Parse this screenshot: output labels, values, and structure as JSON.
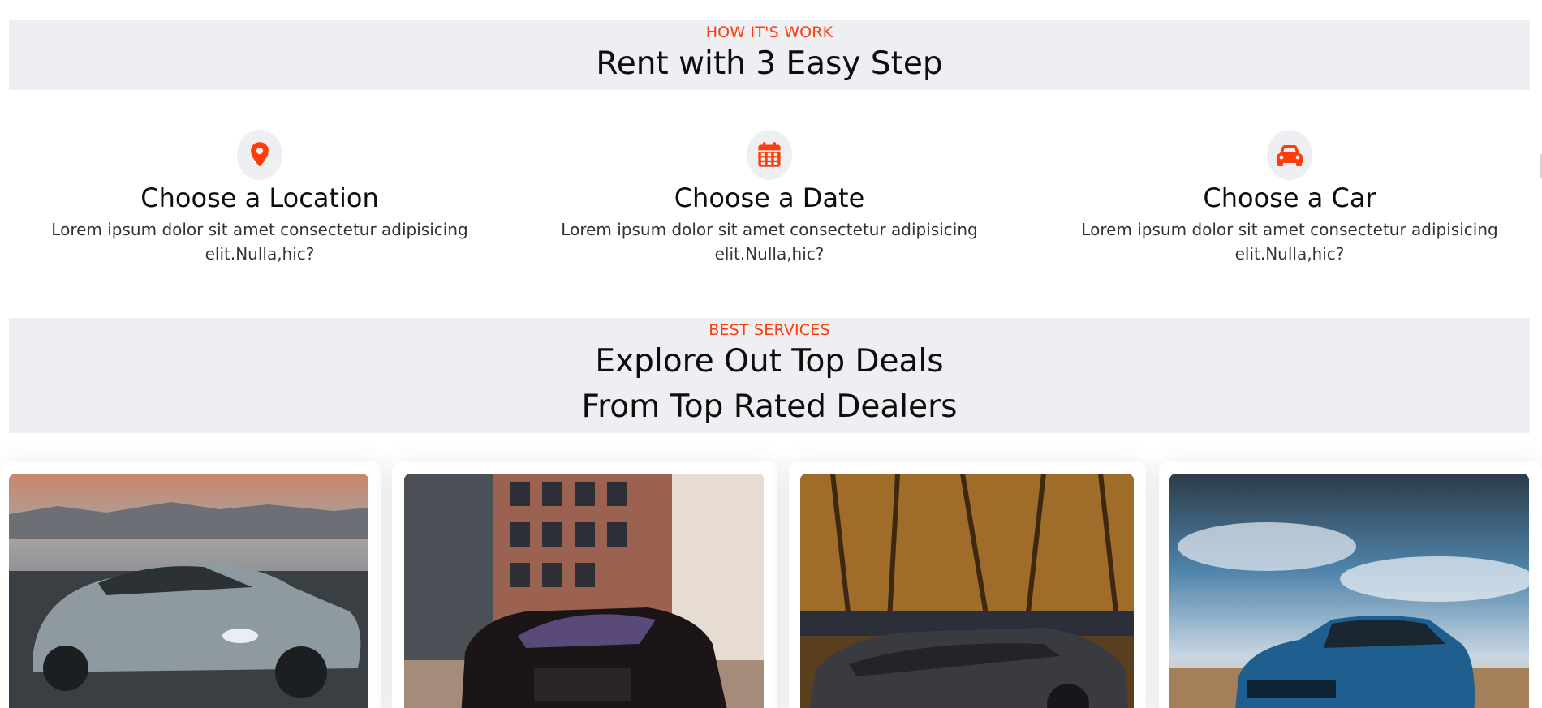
{
  "how_it_works": {
    "eyebrow": "HOW IT'S WORK",
    "heading": "Rent with 3 Easy Step"
  },
  "steps": [
    {
      "icon": "location-pin-icon",
      "title": "Choose a Location",
      "description": "Lorem ipsum dolor sit amet consectetur adipisicing elit.Nulla,hic?"
    },
    {
      "icon": "calendar-icon",
      "title": "Choose a Date",
      "description": "Lorem ipsum dolor sit amet consectetur adipisicing elit.Nulla,hic?"
    },
    {
      "icon": "car-icon",
      "title": "Choose a Car",
      "description": "Lorem ipsum dolor sit amet consectetur adipisicing elit.Nulla,hic?"
    }
  ],
  "best_services": {
    "eyebrow": "BEST SERVICES",
    "heading_line1": "Explore Out Top Deals",
    "heading_line2": "From Top Rated Dealers"
  },
  "deals": [
    {
      "image": "silver-bmw-coupe-at-sunset-photo"
    },
    {
      "image": "black-mercedes-sedan-city-street-photo"
    },
    {
      "image": "dark-rolls-royce-convertible-photo"
    },
    {
      "image": "blue-volvo-suv-field-photo"
    }
  ],
  "colors": {
    "accent": "#ff3d0a",
    "band": "#eeeff3"
  }
}
